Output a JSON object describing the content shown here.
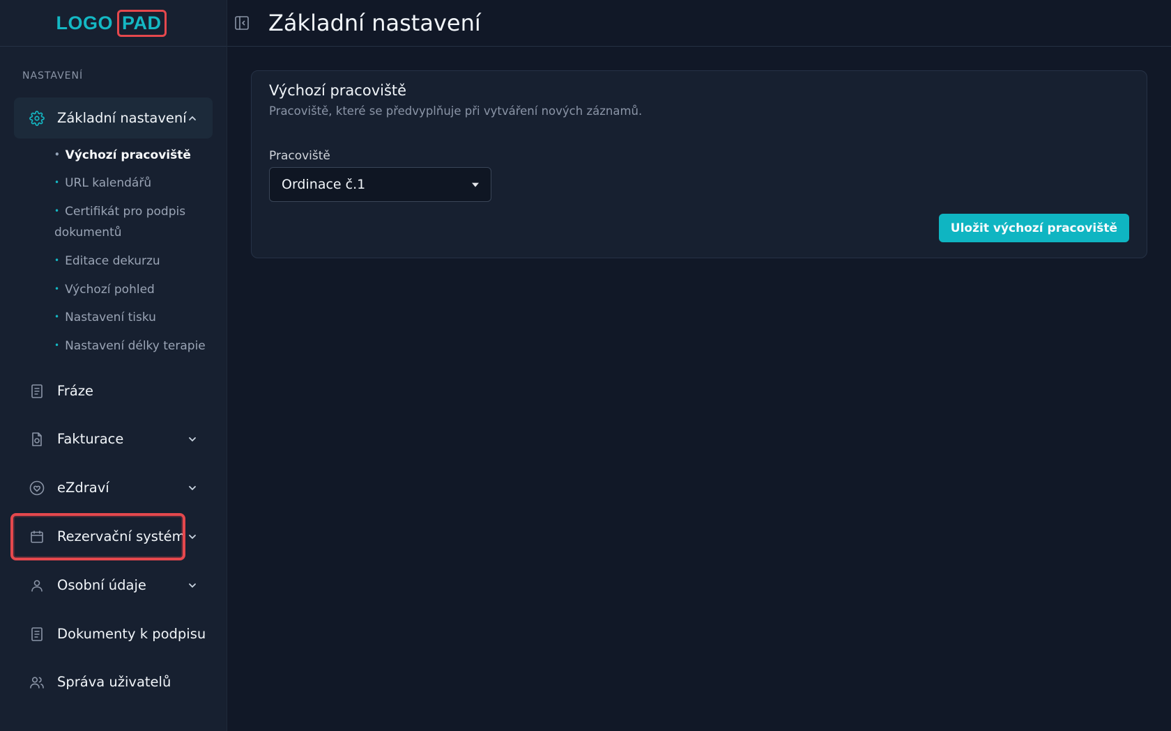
{
  "logo": {
    "part1": "LOGO",
    "part2": "PAD"
  },
  "header": {
    "title": "Základní nastavení"
  },
  "sidebar": {
    "section_label": "NASTAVENÍ",
    "items": [
      {
        "label": "Základní nastavení",
        "icon": "gear-icon",
        "expanded": true
      },
      {
        "label": "Fráze",
        "icon": "document-icon"
      },
      {
        "label": "Fakturace",
        "icon": "invoice-icon"
      },
      {
        "label": "eZdraví",
        "icon": "heart-icon"
      },
      {
        "label": "Rezervační systém",
        "icon": "calendar-icon"
      },
      {
        "label": "Osobní údaje",
        "icon": "user-icon"
      },
      {
        "label": "Dokumenty k podpisu",
        "icon": "document-icon"
      },
      {
        "label": "Správa uživatelů",
        "icon": "users-icon"
      }
    ],
    "subitems": [
      "Výchozí pracoviště",
      "URL kalendářů",
      "Certifikát pro podpis",
      "dokumentů",
      "Editace dekurzu",
      "Výchozí pohled",
      "Nastavení tisku",
      "Nastavení délky terapie"
    ]
  },
  "card": {
    "title": "Výchozí pracoviště",
    "description": "Pracoviště, které se předvyplňuje při vytváření nových záznamů.",
    "field_label": "Pracoviště",
    "select_value": "Ordinace č.1",
    "save_label": "Uložit výchozí pracoviště"
  },
  "colors": {
    "accent": "#14b8c4",
    "highlight": "#e5484d",
    "background": "#111827",
    "sidebar": "#172030"
  }
}
